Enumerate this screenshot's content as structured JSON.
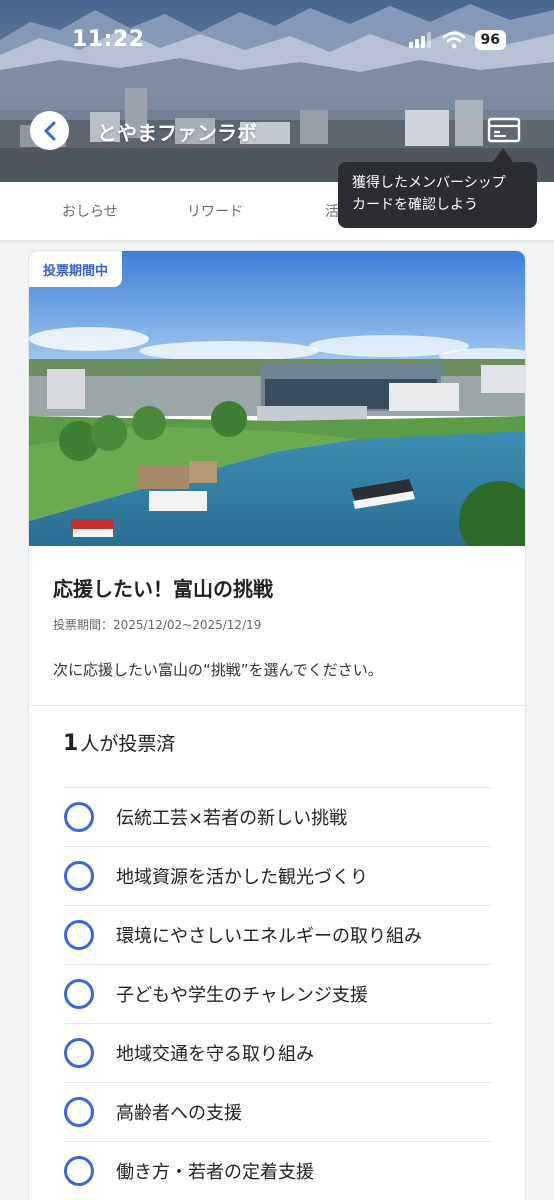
{
  "status_bar": {
    "time": "11:22",
    "battery": "96"
  },
  "header": {
    "title": "とやまファンラボ"
  },
  "tabs": [
    {
      "label": "おしらせ"
    },
    {
      "label": "リワード"
    },
    {
      "label": "活"
    }
  ],
  "tooltip": {
    "line1": "獲得したメンバーシップ",
    "line2": "カードを確認しよう"
  },
  "poll": {
    "badge": "投票期間中",
    "title": "応援したい！富山の挑戦",
    "period": "投票期間：2025/12/02~2025/12/19",
    "description": "次に応援したい富山の“挑戦”を選んでください。",
    "vote_count_number": "1",
    "vote_count_suffix": "人が投票済",
    "options": [
      {
        "label": "伝統工芸×若者の新しい挑戦"
      },
      {
        "label": "地域資源を活かした観光づくり"
      },
      {
        "label": "環境にやさしいエネルギーの取り組み"
      },
      {
        "label": "子どもや学生のチャレンジ支援"
      },
      {
        "label": "地域交通を守る取り組み"
      },
      {
        "label": "高齢者への支援"
      },
      {
        "label": "働き方・若者の定着支援"
      }
    ]
  },
  "colors": {
    "accent": "#3a66d6",
    "badge_text": "#3461c8",
    "tooltip_bg": "#2b2d31"
  }
}
